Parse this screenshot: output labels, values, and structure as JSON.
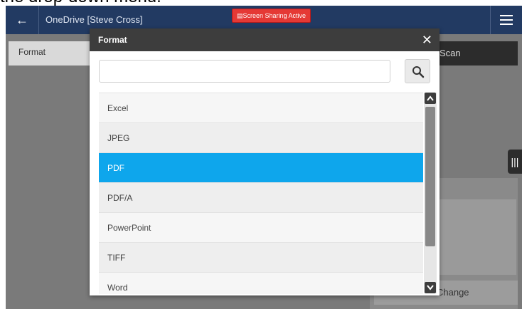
{
  "caption": "the drop-down menu.",
  "topbar": {
    "back_icon": "arrow-left-icon",
    "title": "OneDrive  [Steve Cross]",
    "sharing_badge": "Screen Sharing Active",
    "menu_icon": "hamburger-menu-icon"
  },
  "background": {
    "format_tab": "Format",
    "scan_button": "Scan",
    "change_button": "Change",
    "side_handle": "|||"
  },
  "modal": {
    "title": "Format",
    "close_label": "✕",
    "search": {
      "value": "",
      "placeholder": ""
    },
    "search_icon": "search-icon",
    "items": [
      {
        "label": "Excel",
        "selected": false
      },
      {
        "label": "JPEG",
        "selected": false
      },
      {
        "label": "PDF",
        "selected": true
      },
      {
        "label": "PDF/A",
        "selected": false
      },
      {
        "label": "PowerPoint",
        "selected": false
      },
      {
        "label": "TIFF",
        "selected": false
      },
      {
        "label": "Word",
        "selected": false
      }
    ]
  },
  "colors": {
    "topbar": "#223a62",
    "selected": "#0ea6ec",
    "modal_header": "#3d3d3d",
    "badge": "#e53935"
  }
}
